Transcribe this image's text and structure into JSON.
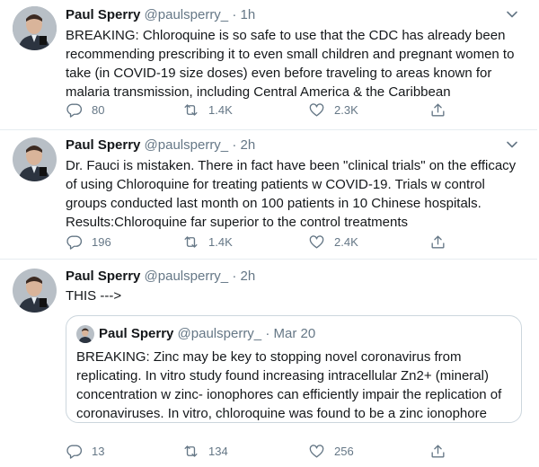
{
  "tweets": [
    {
      "author": {
        "name": "Paul Sperry",
        "handle": "@paulsperry_",
        "time": "1h"
      },
      "text": "BREAKING: Chloroquine is so safe to use that the CDC has already been recommending prescribing it to even small children and pregnant women to take (in COVID-19 size doses) even before traveling to areas known for malaria transmission, including Central America & the Caribbean",
      "replies": "80",
      "retweets": "1.4K",
      "likes": "2.3K"
    },
    {
      "author": {
        "name": "Paul Sperry",
        "handle": "@paulsperry_",
        "time": "2h"
      },
      "text": "Dr. Fauci is mistaken. There in fact have been \"clinical trials\" on the efficacy of using Chloroquine for treating patients w COVID-19. Trials w control groups conducted last month on 100 patients in 10 Chinese hospitals. Results:Chloroquine far superior to the control treatments",
      "replies": "196",
      "retweets": "1.4K",
      "likes": "2.4K"
    },
    {
      "author": {
        "name": "Paul Sperry",
        "handle": "@paulsperry_",
        "time": "2h"
      },
      "text": "THIS --->",
      "quote": {
        "author": {
          "name": "Paul Sperry",
          "handle": "@paulsperry_",
          "time": "Mar 20"
        },
        "text": "BREAKING: Zinc may be key to stopping novel coronavirus from replicating. In vitro study found increasing intracellular Zn2+ (mineral) concentration w zinc- ionophores can efficiently impair the replication of coronaviruses. In vitro, chloroquine was found to be a zinc ionophore"
      },
      "replies": "13",
      "retweets": "134",
      "likes": "256"
    }
  ],
  "separator": "·",
  "icons": {
    "reply": "reply-icon",
    "retweet": "retweet-icon",
    "like": "like-icon",
    "share": "share-icon",
    "more": "chevron-down-icon"
  },
  "colors": {
    "text": "#14171a",
    "secondary": "#657786",
    "border": "#e6ecf0",
    "quote_border": "#ccd6dd"
  }
}
